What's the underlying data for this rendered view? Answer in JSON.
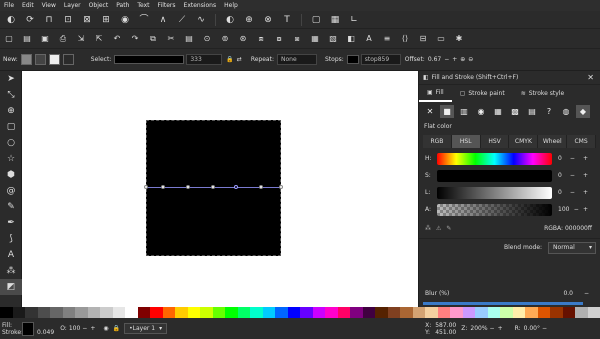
{
  "menu": [
    "File",
    "Edit",
    "View",
    "Layer",
    "Object",
    "Path",
    "Text",
    "Filters",
    "Extensions",
    "Help"
  ],
  "toolctrl": {
    "new_label": "New:",
    "select_label": "Select:",
    "select_value": "333",
    "repeat_label": "Repeat:",
    "repeat_value": "None",
    "stops_label": "Stops:",
    "stop_value": "stop859",
    "offset_label": "Offset:",
    "offset_value": "0.67"
  },
  "panel": {
    "title": "Fill and Stroke (Shift+Ctrl+F)",
    "tabs": [
      "Fill",
      "Stroke paint",
      "Stroke style"
    ],
    "flat_color": "Flat color",
    "modes": [
      "RGB",
      "HSL",
      "HSV",
      "CMYK",
      "Wheel",
      "CMS"
    ],
    "sliders": [
      {
        "key": "H:",
        "value": "0"
      },
      {
        "key": "S:",
        "value": "0"
      },
      {
        "key": "L:",
        "value": "0"
      },
      {
        "key": "A:",
        "value": "100"
      }
    ],
    "rgba_label": "RGBA:",
    "rgba_value": "000000ff",
    "blend_label": "Blend mode:",
    "blend_value": "Normal",
    "blur_label": "Blur (%)",
    "blur_value": "0.0"
  },
  "status": {
    "fill_label": "Fill:",
    "stroke_label": "Stroke:",
    "stroke_width": "0.049",
    "opacity_label": "O:",
    "opacity_value": "100",
    "layer": "•Layer 1",
    "x_label": "X:",
    "x_value": "587.00",
    "y_label": "Y:",
    "y_value": "451.00",
    "z_label": "Z:",
    "zoom": "200%",
    "r_label": "R:",
    "rotation": "0.00°"
  },
  "colors": {
    "canvas": "#ffffff",
    "object_fill": "#000000",
    "accent": "#3a7ac8"
  },
  "palette": [
    "#000000",
    "#1a1a1a",
    "#333333",
    "#4d4d4d",
    "#666666",
    "#808080",
    "#999999",
    "#b3b3b3",
    "#cccccc",
    "#e6e6e6",
    "#ffffff",
    "#800000",
    "#ff0000",
    "#ff6600",
    "#ffcc00",
    "#ffff00",
    "#ccff00",
    "#66ff00",
    "#00ff00",
    "#00ff66",
    "#00ffcc",
    "#00ccff",
    "#0066ff",
    "#0000ff",
    "#6600ff",
    "#cc00ff",
    "#ff00cc",
    "#ff0066",
    "#800080",
    "#400040",
    "#552200",
    "#804020",
    "#aa6633",
    "#d4a373",
    "#f4d0a0",
    "#ff8080",
    "#ff99cc",
    "#cc99ff",
    "#99ccff",
    "#aaffee",
    "#ccffaa",
    "#ffeeaa",
    "#ffaa55",
    "#dd5500",
    "#993300",
    "#661100",
    "#b0b0b0",
    "#d0d0d0"
  ]
}
